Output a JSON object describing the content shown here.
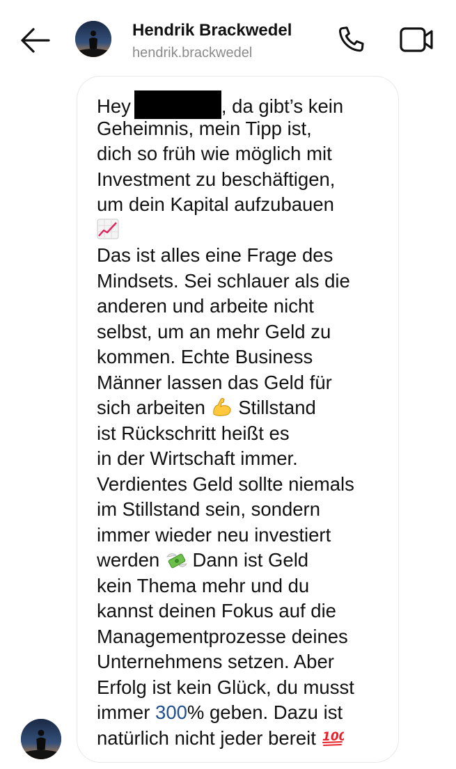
{
  "header": {
    "back_icon": "arrow-left-icon",
    "contact_name": "Hendrik Brackwedel",
    "contact_handle": "hendrik.brackwedel",
    "call_icon": "phone-icon",
    "video_icon": "video-camera-icon"
  },
  "message": {
    "lines": [
      "Hey",
      ", da gibt’s kein",
      "Geheimnis, mein Tipp ist,",
      "dich so früh wie möglich mit",
      "Investment zu beschäftigen,",
      "um dein Kapital aufzubauen",
      "Das ist alles eine Frage des",
      "Mindsets. Sei schlauer als die",
      "anderen und arbeite nicht",
      "selbst, um an mehr Geld zu",
      "kommen. Echte Business",
      "Männer lassen das Geld für",
      "sich arbeiten",
      " Stillstand",
      "ist Rückschritt heißt es",
      "in der Wirtschaft immer.",
      "Verdientes Geld sollte niemals",
      "im Stillstand sein, sondern",
      "immer wieder neu investiert",
      "werden",
      " Dann ist Geld",
      "kein Thema mehr und du",
      "kannst deinen Fokus auf die",
      "Managementprozesse deines",
      "Unternehmens setzen. Aber",
      "Erfolg ist kein Glück, du musst",
      "immer ",
      "300",
      "% geben. Dazu ist",
      "natürlich nicht jeder bereit"
    ],
    "emojis": [
      "chart-increasing-emoji",
      "flexed-biceps-emoji",
      "money-with-wings-emoji",
      "hundred-points-emoji"
    ],
    "redacted": true,
    "colors": {
      "highlight": "#1f4f8f",
      "bubble_border": "#e8e8e8"
    }
  }
}
